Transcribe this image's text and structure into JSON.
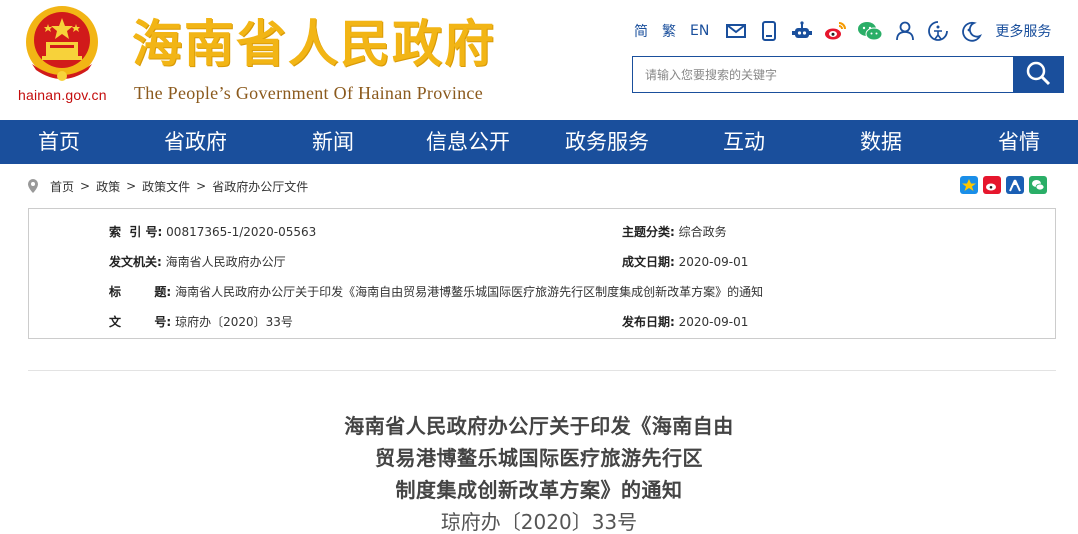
{
  "header": {
    "domain": "hainan.gov.cn",
    "title": "海南省人民政府",
    "subtitle": "The People’s Government Of Hainan Province",
    "emblem_icon": "national-emblem-icon",
    "toolbar": {
      "lang_simplified": "简",
      "lang_traditional": "繁",
      "lang_english": "EN",
      "icons": [
        "mail-icon",
        "mobile-icon",
        "robot-icon",
        "weibo-icon",
        "wechat-icon",
        "user-icon",
        "accessibility-icon",
        "elder-mode-icon"
      ],
      "more_services": "更多服务"
    },
    "search": {
      "placeholder": "请输入您要搜索的关键字",
      "icon": "search-icon"
    }
  },
  "nav": {
    "items": [
      "首页",
      "省政府",
      "新闻",
      "信息公开",
      "政务服务",
      "互动",
      "数据",
      "省情"
    ]
  },
  "breadcrumb": {
    "items": [
      "首页",
      "政策",
      "政策文件",
      "省政府办公厅文件"
    ],
    "separator": ">"
  },
  "share": {
    "icons": [
      "qzone-icon",
      "weibo-share-icon",
      "renren-icon",
      "wechat-share-icon"
    ]
  },
  "info": {
    "index_label": "索  引 号:",
    "index_value": "00817365-1/2020-05563",
    "category_label": "主题分类:",
    "category_value": "综合政务",
    "issuer_label": "发文机关:",
    "issuer_value": "海南省人民政府办公厅",
    "created_label": "成文日期:",
    "created_value": "2020-09-01",
    "title_label": "标        题:",
    "title_value": "海南省人民政府办公厅关于印发《海南自由贸易港博鳌乐城国际医疗旅游先行区制度集成创新改革方案》的通知",
    "docno_label": "文        号:",
    "docno_value": "琼府办〔2020〕33号",
    "published_label": "发布日期:",
    "published_value": "2020-09-01"
  },
  "article": {
    "title_line1": "海南省人民政府办公厅关于印发《海南自由",
    "title_line2": "贸易港博鳌乐城国际医疗旅游先行区",
    "title_line3": "制度集成创新改革方案》的通知",
    "doc_number": "琼府办〔2020〕33号"
  },
  "colors": {
    "brand_blue": "#1a4f9c",
    "title_gold": "#f2b515",
    "emblem_red": "#c40d0d"
  }
}
